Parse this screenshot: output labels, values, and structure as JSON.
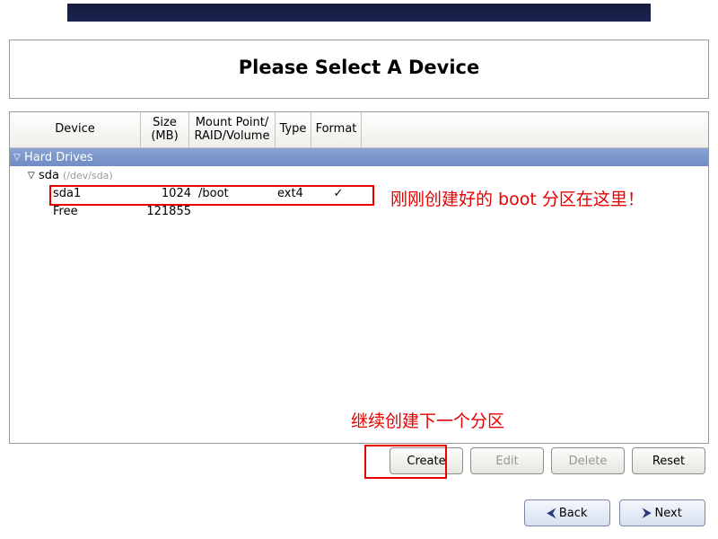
{
  "header": {
    "title": "Please Select A Device"
  },
  "columns": {
    "device": "Device",
    "size": "Size\n(MB)",
    "mount": "Mount Point/\nRAID/Volume",
    "type": "Type",
    "format": "Format"
  },
  "tree": {
    "group_label": "Hard Drives",
    "disk": {
      "name": "sda",
      "path": "(/dev/sda)"
    },
    "rows": [
      {
        "device": "sda1",
        "size": "1024",
        "mount": "/boot",
        "type": "ext4",
        "format": "✓"
      },
      {
        "device": "Free",
        "size": "121855",
        "mount": "",
        "type": "",
        "format": ""
      }
    ]
  },
  "annotations": {
    "boot_here": "刚刚创建好的 boot 分区在这里！",
    "next_partition": "继续创建下一个分区"
  },
  "buttons": {
    "create": "Create",
    "edit": "Edit",
    "delete": "Delete",
    "reset": "Reset",
    "back": "Back",
    "next": "Next"
  }
}
